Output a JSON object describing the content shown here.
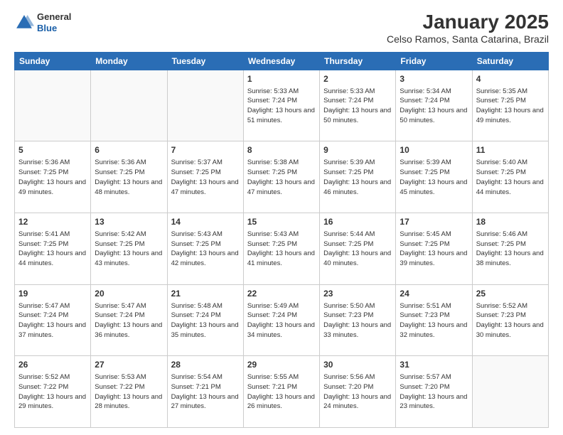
{
  "header": {
    "logo": {
      "general": "General",
      "blue": "Blue"
    },
    "title": "January 2025",
    "subtitle": "Celso Ramos, Santa Catarina, Brazil"
  },
  "weekdays": [
    "Sunday",
    "Monday",
    "Tuesday",
    "Wednesday",
    "Thursday",
    "Friday",
    "Saturday"
  ],
  "weeks": [
    [
      {
        "day": "",
        "sunrise": "",
        "sunset": "",
        "daylight": ""
      },
      {
        "day": "",
        "sunrise": "",
        "sunset": "",
        "daylight": ""
      },
      {
        "day": "",
        "sunrise": "",
        "sunset": "",
        "daylight": ""
      },
      {
        "day": "1",
        "sunrise": "Sunrise: 5:33 AM",
        "sunset": "Sunset: 7:24 PM",
        "daylight": "Daylight: 13 hours and 51 minutes."
      },
      {
        "day": "2",
        "sunrise": "Sunrise: 5:33 AM",
        "sunset": "Sunset: 7:24 PM",
        "daylight": "Daylight: 13 hours and 50 minutes."
      },
      {
        "day": "3",
        "sunrise": "Sunrise: 5:34 AM",
        "sunset": "Sunset: 7:24 PM",
        "daylight": "Daylight: 13 hours and 50 minutes."
      },
      {
        "day": "4",
        "sunrise": "Sunrise: 5:35 AM",
        "sunset": "Sunset: 7:25 PM",
        "daylight": "Daylight: 13 hours and 49 minutes."
      }
    ],
    [
      {
        "day": "5",
        "sunrise": "Sunrise: 5:36 AM",
        "sunset": "Sunset: 7:25 PM",
        "daylight": "Daylight: 13 hours and 49 minutes."
      },
      {
        "day": "6",
        "sunrise": "Sunrise: 5:36 AM",
        "sunset": "Sunset: 7:25 PM",
        "daylight": "Daylight: 13 hours and 48 minutes."
      },
      {
        "day": "7",
        "sunrise": "Sunrise: 5:37 AM",
        "sunset": "Sunset: 7:25 PM",
        "daylight": "Daylight: 13 hours and 47 minutes."
      },
      {
        "day": "8",
        "sunrise": "Sunrise: 5:38 AM",
        "sunset": "Sunset: 7:25 PM",
        "daylight": "Daylight: 13 hours and 47 minutes."
      },
      {
        "day": "9",
        "sunrise": "Sunrise: 5:39 AM",
        "sunset": "Sunset: 7:25 PM",
        "daylight": "Daylight: 13 hours and 46 minutes."
      },
      {
        "day": "10",
        "sunrise": "Sunrise: 5:39 AM",
        "sunset": "Sunset: 7:25 PM",
        "daylight": "Daylight: 13 hours and 45 minutes."
      },
      {
        "day": "11",
        "sunrise": "Sunrise: 5:40 AM",
        "sunset": "Sunset: 7:25 PM",
        "daylight": "Daylight: 13 hours and 44 minutes."
      }
    ],
    [
      {
        "day": "12",
        "sunrise": "Sunrise: 5:41 AM",
        "sunset": "Sunset: 7:25 PM",
        "daylight": "Daylight: 13 hours and 44 minutes."
      },
      {
        "day": "13",
        "sunrise": "Sunrise: 5:42 AM",
        "sunset": "Sunset: 7:25 PM",
        "daylight": "Daylight: 13 hours and 43 minutes."
      },
      {
        "day": "14",
        "sunrise": "Sunrise: 5:43 AM",
        "sunset": "Sunset: 7:25 PM",
        "daylight": "Daylight: 13 hours and 42 minutes."
      },
      {
        "day": "15",
        "sunrise": "Sunrise: 5:43 AM",
        "sunset": "Sunset: 7:25 PM",
        "daylight": "Daylight: 13 hours and 41 minutes."
      },
      {
        "day": "16",
        "sunrise": "Sunrise: 5:44 AM",
        "sunset": "Sunset: 7:25 PM",
        "daylight": "Daylight: 13 hours and 40 minutes."
      },
      {
        "day": "17",
        "sunrise": "Sunrise: 5:45 AM",
        "sunset": "Sunset: 7:25 PM",
        "daylight": "Daylight: 13 hours and 39 minutes."
      },
      {
        "day": "18",
        "sunrise": "Sunrise: 5:46 AM",
        "sunset": "Sunset: 7:25 PM",
        "daylight": "Daylight: 13 hours and 38 minutes."
      }
    ],
    [
      {
        "day": "19",
        "sunrise": "Sunrise: 5:47 AM",
        "sunset": "Sunset: 7:24 PM",
        "daylight": "Daylight: 13 hours and 37 minutes."
      },
      {
        "day": "20",
        "sunrise": "Sunrise: 5:47 AM",
        "sunset": "Sunset: 7:24 PM",
        "daylight": "Daylight: 13 hours and 36 minutes."
      },
      {
        "day": "21",
        "sunrise": "Sunrise: 5:48 AM",
        "sunset": "Sunset: 7:24 PM",
        "daylight": "Daylight: 13 hours and 35 minutes."
      },
      {
        "day": "22",
        "sunrise": "Sunrise: 5:49 AM",
        "sunset": "Sunset: 7:24 PM",
        "daylight": "Daylight: 13 hours and 34 minutes."
      },
      {
        "day": "23",
        "sunrise": "Sunrise: 5:50 AM",
        "sunset": "Sunset: 7:23 PM",
        "daylight": "Daylight: 13 hours and 33 minutes."
      },
      {
        "day": "24",
        "sunrise": "Sunrise: 5:51 AM",
        "sunset": "Sunset: 7:23 PM",
        "daylight": "Daylight: 13 hours and 32 minutes."
      },
      {
        "day": "25",
        "sunrise": "Sunrise: 5:52 AM",
        "sunset": "Sunset: 7:23 PM",
        "daylight": "Daylight: 13 hours and 30 minutes."
      }
    ],
    [
      {
        "day": "26",
        "sunrise": "Sunrise: 5:52 AM",
        "sunset": "Sunset: 7:22 PM",
        "daylight": "Daylight: 13 hours and 29 minutes."
      },
      {
        "day": "27",
        "sunrise": "Sunrise: 5:53 AM",
        "sunset": "Sunset: 7:22 PM",
        "daylight": "Daylight: 13 hours and 28 minutes."
      },
      {
        "day": "28",
        "sunrise": "Sunrise: 5:54 AM",
        "sunset": "Sunset: 7:21 PM",
        "daylight": "Daylight: 13 hours and 27 minutes."
      },
      {
        "day": "29",
        "sunrise": "Sunrise: 5:55 AM",
        "sunset": "Sunset: 7:21 PM",
        "daylight": "Daylight: 13 hours and 26 minutes."
      },
      {
        "day": "30",
        "sunrise": "Sunrise: 5:56 AM",
        "sunset": "Sunset: 7:20 PM",
        "daylight": "Daylight: 13 hours and 24 minutes."
      },
      {
        "day": "31",
        "sunrise": "Sunrise: 5:57 AM",
        "sunset": "Sunset: 7:20 PM",
        "daylight": "Daylight: 13 hours and 23 minutes."
      },
      {
        "day": "",
        "sunrise": "",
        "sunset": "",
        "daylight": ""
      }
    ]
  ]
}
